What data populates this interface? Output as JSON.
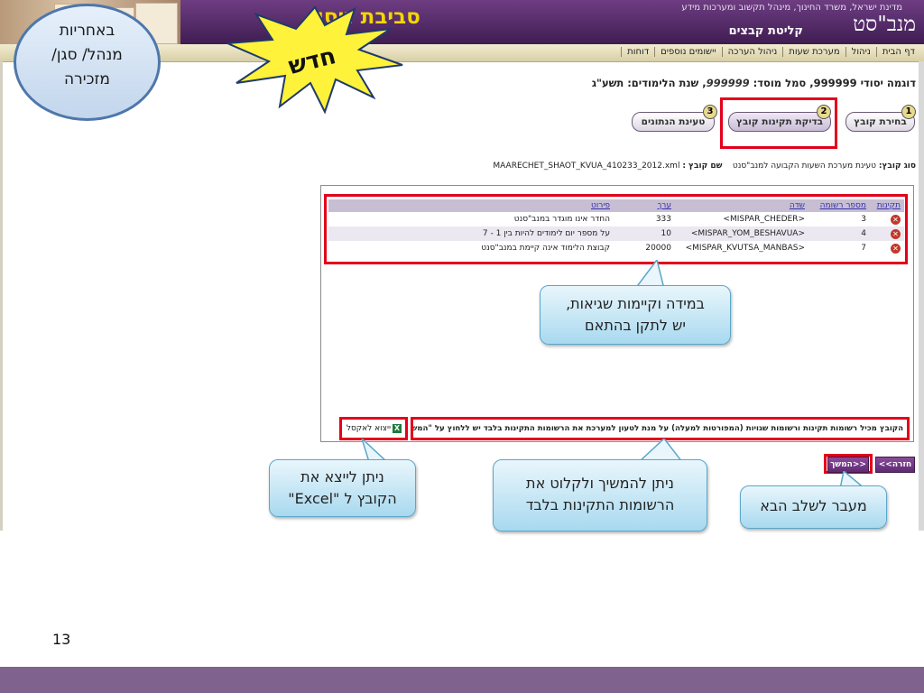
{
  "header": {
    "site_title": "סביבת ניסוי",
    "ministry_line": "מדינת ישראל, משרד החינוך, מינהל תקשוב ומערכות מידע",
    "logo": "מנב\"סט",
    "subtitle": "קליטת קבצים"
  },
  "nav": {
    "items": [
      "דף הבית",
      "ניהול",
      "מערכת שעות",
      "ניהול הערכה",
      "יישומים נוספים",
      "דוחות"
    ]
  },
  "org_line": {
    "label_school": "דוגמה יסודי",
    "school_number": "999999",
    "label_symbol": "סמל מוסד:",
    "symbol_number": "999999",
    "label_year": "שנת הלימודים:",
    "year": "תשע\"ג"
  },
  "steps": [
    {
      "num": "1",
      "label": "בחירת קובץ"
    },
    {
      "num": "2",
      "label": "בדיקת תקינות קובץ"
    },
    {
      "num": "3",
      "label": "טעינת הנתונים"
    }
  ],
  "file_info": {
    "type_label": "סוג קובץ:",
    "type_value": "טעינת מערכת השעות הקבועה למנב\"סנט",
    "name_label": "שם קובץ :",
    "name_value": "MAARECHET_SHAOT_KVUA_410233_2012.xml"
  },
  "table": {
    "headers": [
      "תקינות",
      "מספר רשומה",
      "שדה",
      "ערך",
      "פירוט"
    ],
    "rows": [
      {
        "record": "3",
        "field": "<MISPAR_CHEDER>",
        "value": "333",
        "detail": "החדר אינו מוגדר במנב\"סנט"
      },
      {
        "record": "4",
        "field": "<MISPAR_YOM_BESHAVUA>",
        "value": "10",
        "detail": "על מספר יום לימודים להיות בין 1 - 7"
      },
      {
        "record": "7",
        "field": "<MISPAR_KVUTSA_MANBAS>",
        "value": "20000",
        "detail": "קבוצת הלימוד אינה קיימת במנב\"סנט"
      }
    ]
  },
  "status_message": "הקובץ מכיל רשומות תקינות ורשומות שגויות (המפורטות למעלה) על מנת לטעון למערכת את הרשומות התקינות בלבד יש ללחוץ על \"המשך\".",
  "export_label": "ייצוא לאקסל",
  "buttons": {
    "back": "<<חזרה",
    "next": "המשך>>"
  },
  "callouts": {
    "manager": [
      "באחריות",
      "מנהל/ סגן/",
      "מזכירה"
    ],
    "new_badge": "חדש",
    "errors": [
      "במידה וקיימות שגיאות,",
      "יש לתקן בהתאם"
    ],
    "excel": [
      "ניתן לייצא את",
      "הקובץ ל \"Excel\""
    ],
    "continue": [
      "ניתן להמשיך ולקלוט את",
      "הרשומות התקינות בלבד"
    ],
    "next_step": "מעבר לשלב הבא"
  },
  "slide_number": "13",
  "colors": {
    "header_purple": "#5a2d6e",
    "highlight_red": "#e3001b",
    "title_yellow": "#f2d700",
    "callout_blue": "#a8d9ef",
    "footer_purple": "#7f628e"
  }
}
